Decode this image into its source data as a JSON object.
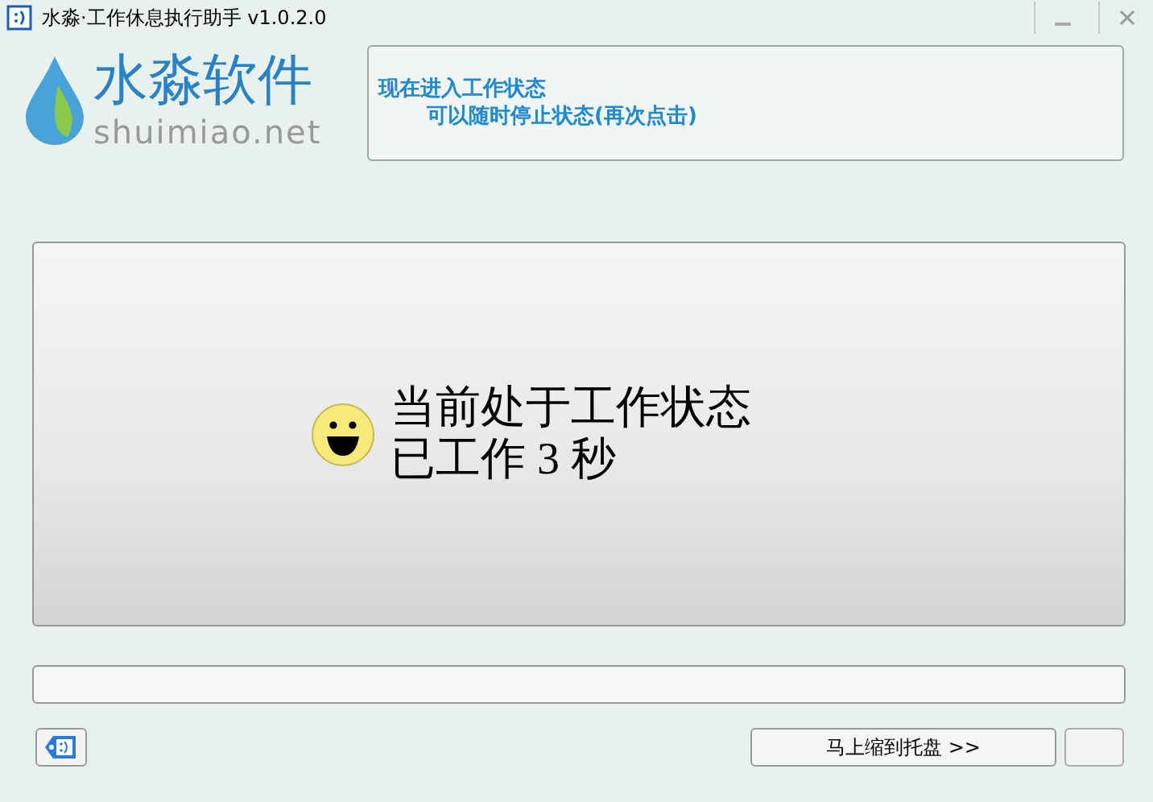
{
  "window": {
    "title": "水淼·工作休息执行助手 v1.0.2.0"
  },
  "logo": {
    "name": "水淼软件",
    "site": "shuimiao.net"
  },
  "message": {
    "line1": "现在进入工作状态",
    "line2": "可以随时停止状态(再次点击)"
  },
  "status": {
    "state": "当前处于工作状态",
    "elapsed": "已工作 3 秒"
  },
  "buttons": {
    "tray": "马上缩到托盘 >>"
  }
}
